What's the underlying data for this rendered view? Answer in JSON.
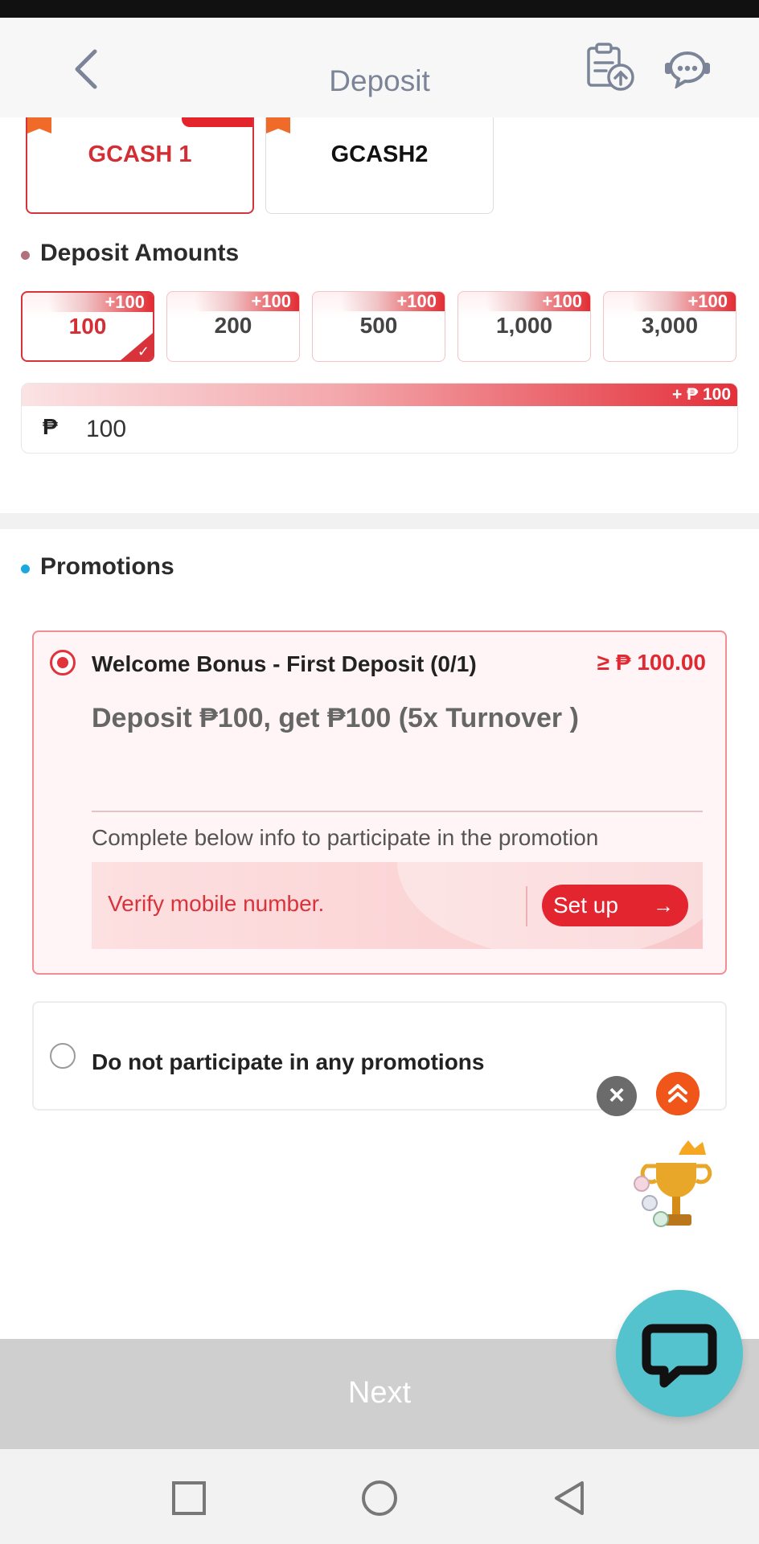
{
  "header": {
    "title": "Deposit",
    "back_icon": "chevron-left-icon",
    "record_icon": "clipboard-upload-icon",
    "support_icon": "chat-support-icon"
  },
  "payment_methods": [
    {
      "name": "GCASH 1",
      "selected": true
    },
    {
      "name": "GCASH2",
      "selected": false
    }
  ],
  "deposit_amounts": {
    "title": "Deposit Amounts",
    "options": [
      {
        "value": "100",
        "bonus": "+100",
        "selected": true
      },
      {
        "value": "200",
        "bonus": "+100",
        "selected": false
      },
      {
        "value": "500",
        "bonus": "+100",
        "selected": false
      },
      {
        "value": "1,000",
        "bonus": "+100",
        "selected": false
      },
      {
        "value": "3,000",
        "bonus": "+100",
        "selected": false
      }
    ],
    "currency_symbol": "₱",
    "input_value": "100",
    "bonus_banner": "+ ₱ 100"
  },
  "promotions": {
    "title": "Promotions",
    "welcome": {
      "name": "Welcome Bonus - First Deposit (0/1)",
      "minimum": "≥ ₱ 100.00",
      "description": "Deposit ₱100, get ₱100 (5x Turnover )",
      "note": "Complete below info to participate in the promotion",
      "verify_text": "Verify mobile number.",
      "setup_label": "Set up",
      "selected": true
    },
    "none_label": "Do not participate in any promotions"
  },
  "next_label": "Next",
  "colors": {
    "accent": "#e3252f",
    "header_text": "#7c8597",
    "chat_fab": "#55c3cd",
    "next_bar": "#cfcfcf"
  }
}
